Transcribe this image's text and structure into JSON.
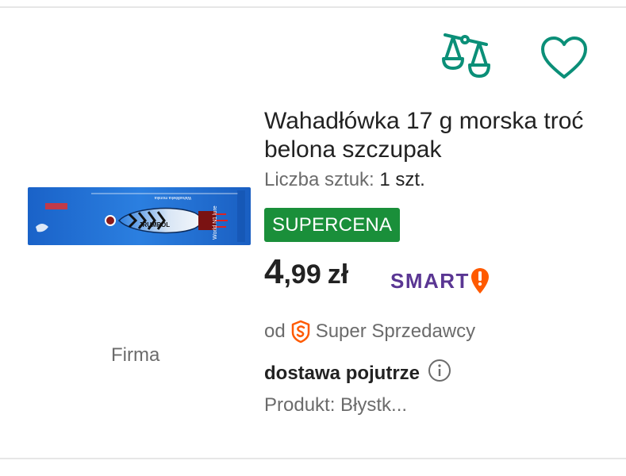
{
  "listing": {
    "title": "Wahadłówka 17 g morska troć belona szczupak",
    "quantity_label": "Liczba sztuk:",
    "quantity_value": "1 szt.",
    "badge": "SUPERCENA",
    "price": {
      "integer": "4",
      "decimal": ",99",
      "currency": "zł"
    },
    "smart_label": "SMART",
    "seller_prefix": "od",
    "seller_label": "Super Sprzedawcy",
    "delivery": "dostawa pojutrze",
    "product": "Produkt: Błystk...",
    "brand": "Firma",
    "thumbnail": {
      "brand_text": "JRUMPOL",
      "tagline": "World N1 lure",
      "small_text": "Wahadłówka morska"
    }
  },
  "icons": {
    "compare": "compare-scales-icon",
    "favorite": "heart-icon",
    "smart_badge": "smart-exclamation-icon",
    "super_seller": "super-seller-icon",
    "info": "info-icon"
  },
  "colors": {
    "icon_teal": "#0b8f78",
    "badge_green": "#1a8f3a",
    "smart_purple": "#5a3693",
    "smart_orange": "#ff5a00",
    "text_dark": "#222222",
    "text_muted": "#6b6b6b"
  }
}
